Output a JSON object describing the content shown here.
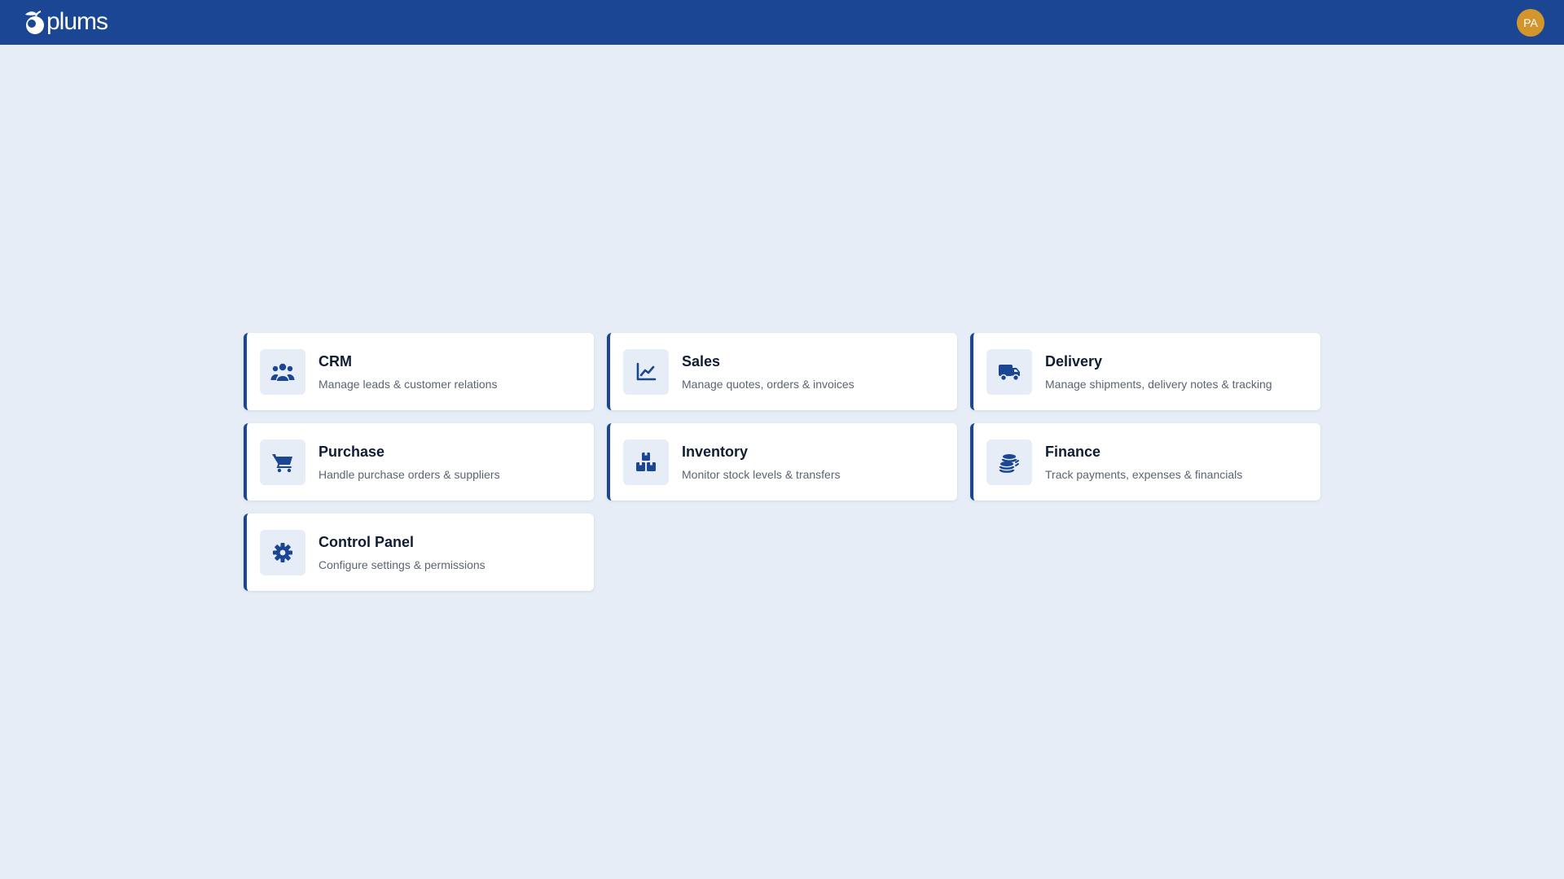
{
  "header": {
    "logo_text": "plums",
    "avatar_initials": "PA",
    "colors": {
      "bar": "#1a4694",
      "avatar": "#d3962c"
    }
  },
  "modules": [
    {
      "title": "CRM",
      "description": "Manage leads & customer relations",
      "icon": "users-icon"
    },
    {
      "title": "Sales",
      "description": "Manage quotes, orders & invoices",
      "icon": "chart-line-icon"
    },
    {
      "title": "Delivery",
      "description": "Manage shipments, delivery notes & tracking",
      "icon": "truck-icon"
    },
    {
      "title": "Purchase",
      "description": "Handle purchase orders & suppliers",
      "icon": "cart-icon"
    },
    {
      "title": "Inventory",
      "description": "Monitor stock levels & transfers",
      "icon": "boxes-icon"
    },
    {
      "title": "Finance",
      "description": "Track payments, expenses & financials",
      "icon": "coins-icon"
    },
    {
      "title": "Control Panel",
      "description": "Configure settings & permissions",
      "icon": "gear-icon"
    }
  ],
  "colors": {
    "accent": "#1a4694",
    "background": "#e6edf7",
    "icon_bg": "#e6edf7"
  }
}
